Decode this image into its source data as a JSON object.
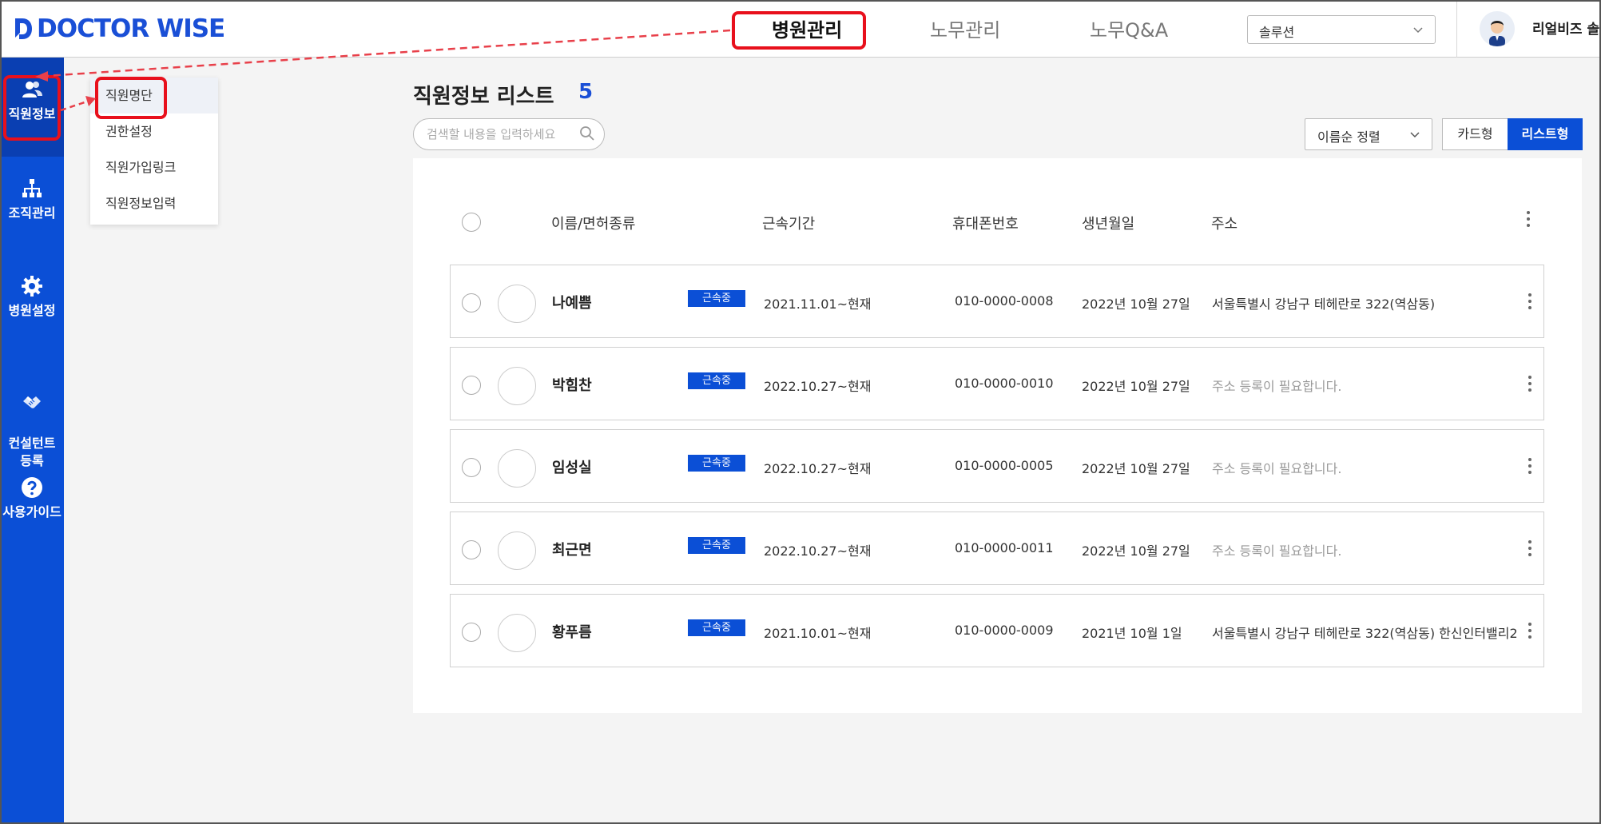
{
  "header": {
    "logo_text": "DOCTOR WISE",
    "nav": [
      {
        "label": "병원관리",
        "active": true
      },
      {
        "label": "노무관리",
        "active": false
      },
      {
        "label": "노무Q&A",
        "active": false
      }
    ],
    "solution_select": "솔루션",
    "user_name": "리얼비즈 솔"
  },
  "sidebar": {
    "items": [
      {
        "label": "직원정보",
        "icon": "users-icon",
        "active": true
      },
      {
        "label": "조직관리",
        "icon": "org-chart-icon",
        "active": false
      },
      {
        "label": "병원설정",
        "icon": "gear-icon",
        "active": false
      },
      {
        "label": "컨설턴트\n등록",
        "icon": "handshake-icon",
        "active": false
      },
      {
        "label": "사용가이드",
        "icon": "help-icon",
        "active": false
      }
    ]
  },
  "submenu": {
    "items": [
      {
        "label": "직원명단",
        "selected": true
      },
      {
        "label": "권한설정",
        "selected": false
      },
      {
        "label": "직원가입링크",
        "selected": false
      },
      {
        "label": "직원정보입력",
        "selected": false
      }
    ]
  },
  "main": {
    "title": "직원정보 리스트",
    "count": "5",
    "search_placeholder": "검색할 내용을 입력하세요",
    "sort_label": "이름순 정렬",
    "view_card": "카드형",
    "view_list": "리스트형",
    "columns": [
      "이름/면허종류",
      "근속기간",
      "휴대폰번호",
      "생년월일",
      "주소"
    ],
    "rows": [
      {
        "name": "나예쁨",
        "badge": "근속중",
        "period": "2021.11.01~현재",
        "phone": "010-0000-0008",
        "birth": "2022년 10월 27일",
        "address": "서울특별시 강남구 테헤란로 322(역삼동)",
        "address_missing": false
      },
      {
        "name": "박힘찬",
        "badge": "근속중",
        "period": "2022.10.27~현재",
        "phone": "010-0000-0010",
        "birth": "2022년 10월 27일",
        "address": "주소 등록이 필요합니다.",
        "address_missing": true
      },
      {
        "name": "임성실",
        "badge": "근속중",
        "period": "2022.10.27~현재",
        "phone": "010-0000-0005",
        "birth": "2022년 10월 27일",
        "address": "주소 등록이 필요합니다.",
        "address_missing": true
      },
      {
        "name": "최근면",
        "badge": "근속중",
        "period": "2022.10.27~현재",
        "phone": "010-0000-0011",
        "birth": "2022년 10월 27일",
        "address": "주소 등록이 필요합니다.",
        "address_missing": true
      },
      {
        "name": "황푸름",
        "badge": "근속중",
        "period": "2021.10.01~현재",
        "phone": "010-0000-0009",
        "birth": "2021년 10월 1일",
        "address": "서울특별시 강남구 테헤란로 322(역삼동) 한신인터밸리2",
        "address_missing": false
      }
    ]
  },
  "colors": {
    "brand": "#0b4fd6",
    "highlight": "#e8101c"
  }
}
